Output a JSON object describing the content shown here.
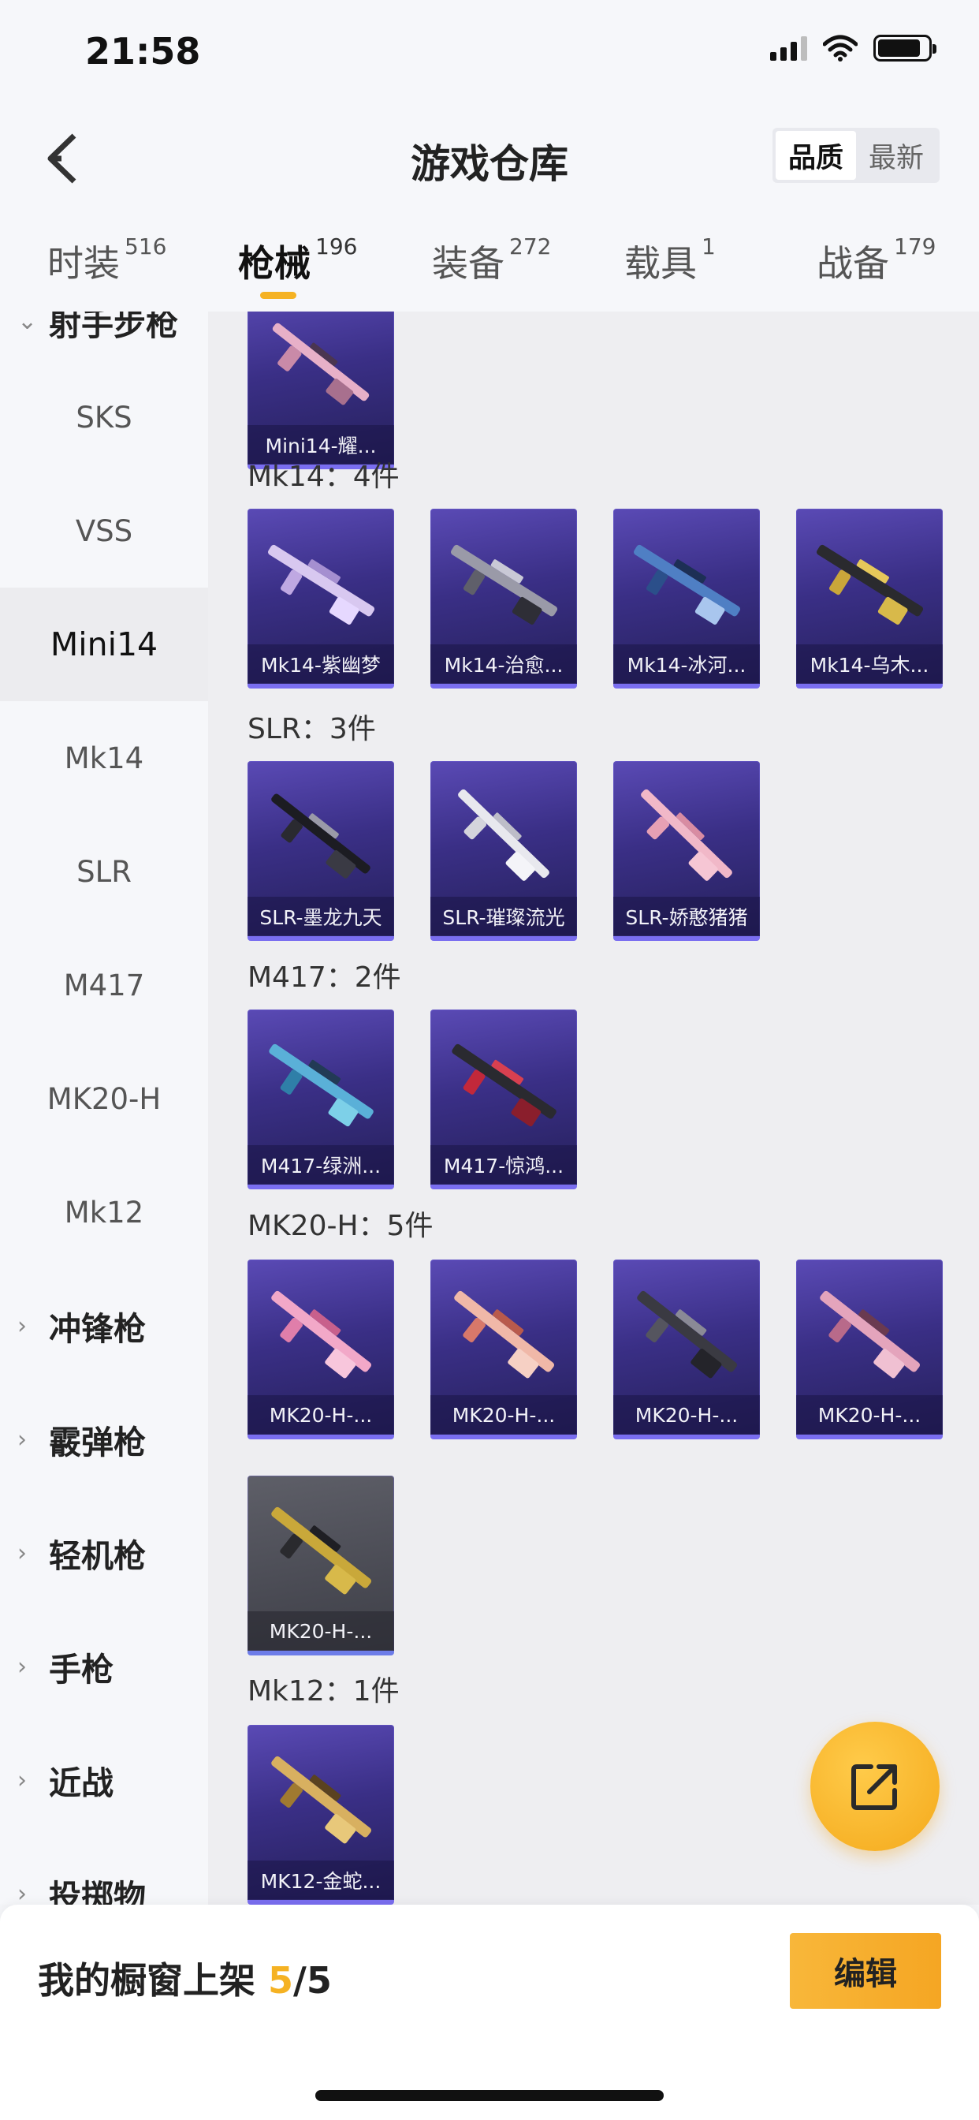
{
  "status_bar": {
    "time": "21:58"
  },
  "header": {
    "title": "游戏仓库",
    "sort_options": [
      {
        "label": "品质",
        "active": true
      },
      {
        "label": "最新",
        "active": false
      }
    ]
  },
  "tabs": [
    {
      "label": "时装",
      "count": "516",
      "active": false
    },
    {
      "label": "枪械",
      "count": "196",
      "active": true
    },
    {
      "label": "装备",
      "count": "272",
      "active": false
    },
    {
      "label": "载具",
      "count": "1",
      "active": false
    },
    {
      "label": "战备",
      "count": "179",
      "active": false
    }
  ],
  "sidebar": {
    "open_category": "射手步枪",
    "sub_items": [
      "SKS",
      "VSS",
      "Mini14",
      "Mk14",
      "SLR",
      "M417",
      "MK20-H",
      "Mk12"
    ],
    "active_item": "Mini14",
    "categories": [
      "冲锋枪",
      "霰弹枪",
      "轻机枪",
      "手枪",
      "近战",
      "投掷物"
    ]
  },
  "groups": [
    {
      "title": "",
      "items": [
        {
          "label": "Mini14-耀..."
        }
      ]
    },
    {
      "title": "Mk14：4件",
      "items": [
        {
          "label": "Mk14-紫幽梦"
        },
        {
          "label": "Mk14-治愈..."
        },
        {
          "label": "Mk14-冰河..."
        },
        {
          "label": "Mk14-乌木..."
        }
      ]
    },
    {
      "title": "SLR：3件",
      "items": [
        {
          "label": "SLR-墨龙九天"
        },
        {
          "label": "SLR-璀璨流光"
        },
        {
          "label": "SLR-娇憨猪猪"
        }
      ]
    },
    {
      "title": "M417：2件",
      "items": [
        {
          "label": "M417-绿洲..."
        },
        {
          "label": "M417-惊鸿..."
        }
      ]
    },
    {
      "title": "MK20-H：5件",
      "items": [
        {
          "label": "MK20-H-..."
        },
        {
          "label": "MK20-H-..."
        },
        {
          "label": "MK20-H-..."
        },
        {
          "label": "MK20-H-..."
        },
        {
          "label": "MK20-H-..."
        }
      ]
    },
    {
      "title": "Mk12：1件",
      "items": [
        {
          "label": "MK12-金蛇..."
        }
      ]
    }
  ],
  "bottom_bar": {
    "shelf_label": "我的橱窗上架 ",
    "shelf_used": "5",
    "shelf_total": "/5",
    "edit_label": "编辑"
  },
  "colors": {
    "accent": "#f5b223",
    "card_top": "#5a4ab5",
    "card_bottom": "#25205a"
  },
  "icons": {
    "back": "chevron-left-icon",
    "share": "share-external-icon"
  }
}
